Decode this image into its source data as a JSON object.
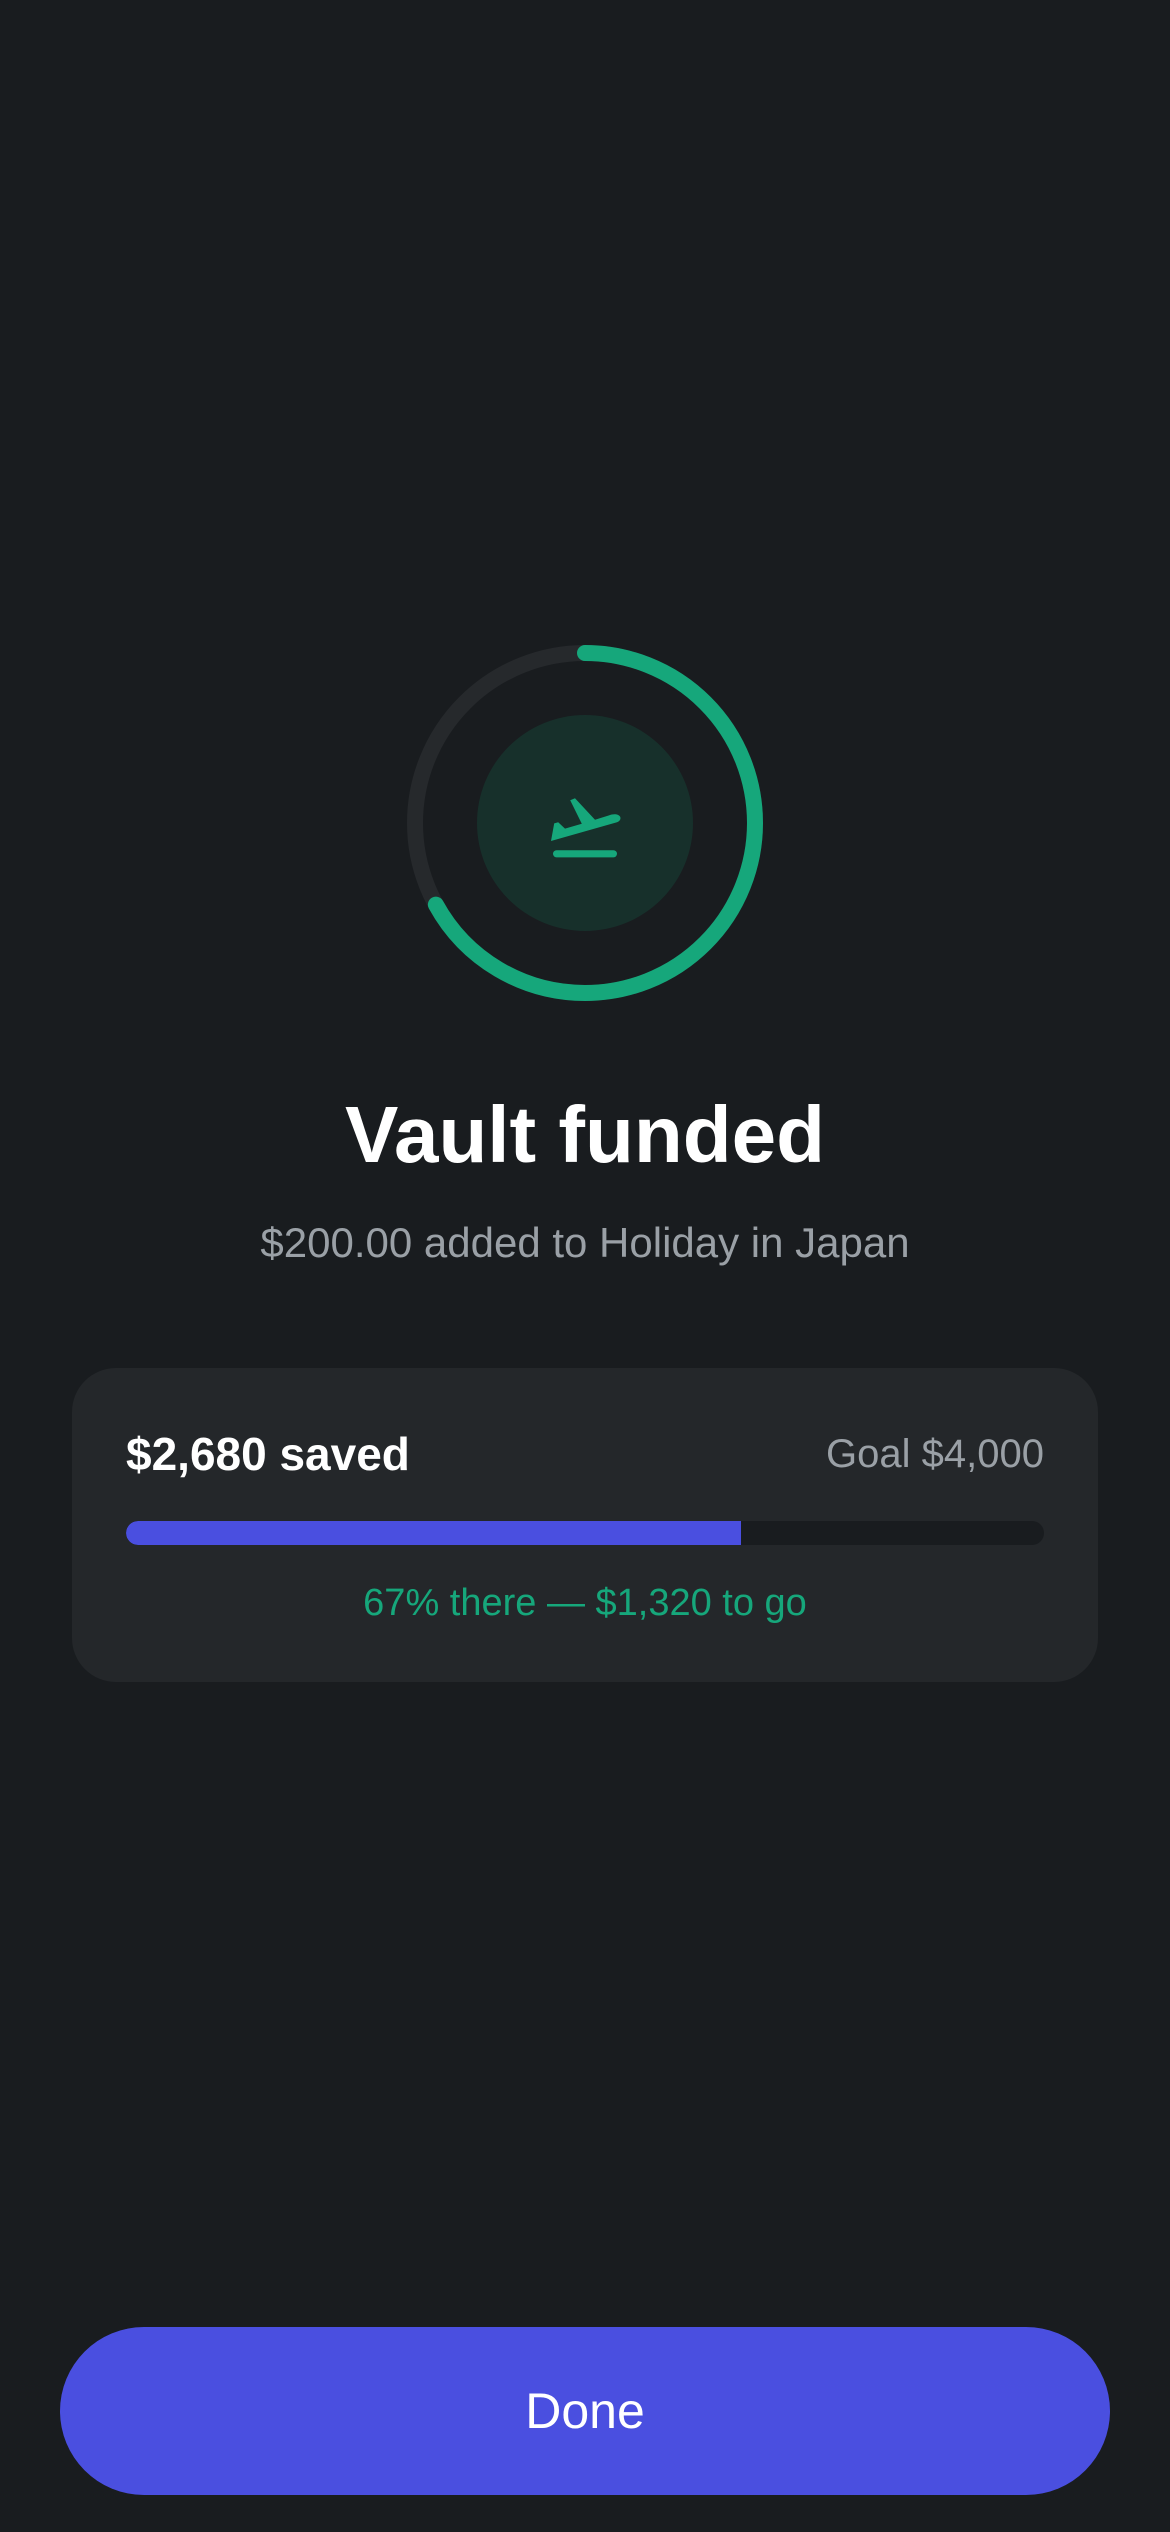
{
  "status": {
    "title": "Vault funded",
    "subtitle": "$200.00 added to Holiday in Japan",
    "icon": "plane-departure-icon",
    "ring_progress": 0.67
  },
  "summary_card": {
    "saved_label": "$2,680 saved",
    "goal_label": "Goal $4,000",
    "progress_fraction": 0.67,
    "progress_text": "67% there — $1,320 to go"
  },
  "actions": {
    "done_label": "Done"
  },
  "colors": {
    "background": "#191c1f",
    "card": "#24272a",
    "accent_green": "#16a77b",
    "accent_indigo": "#4a4fe0",
    "muted_text": "#9aa0a6"
  }
}
